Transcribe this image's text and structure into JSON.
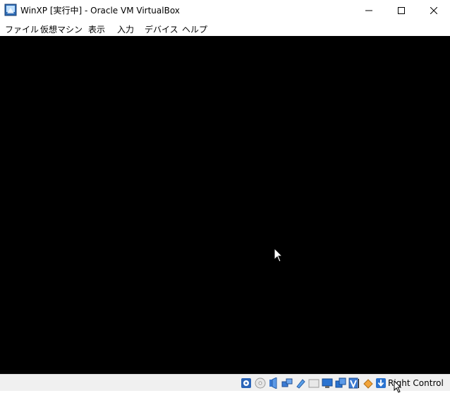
{
  "window": {
    "title": "WinXP [実行中] - Oracle VM VirtualBox"
  },
  "menu": {
    "items": [
      "ファイル",
      "仮想マシン",
      "表示",
      "入力",
      "デバイス",
      "ヘルプ"
    ]
  },
  "statusbar": {
    "icons": [
      "hard-disk-icon",
      "optical-disk-icon",
      "audio-icon",
      "network-icon",
      "usb-icon",
      "shared-folder-icon",
      "display-icon",
      "video-capture-icon",
      "virtualization-icon",
      "mouse-integration-icon",
      "keyboard-capture-icon"
    ],
    "host_key": "Right Control"
  },
  "colors": {
    "screen": "#000000",
    "accent": "#1a6fc9"
  }
}
